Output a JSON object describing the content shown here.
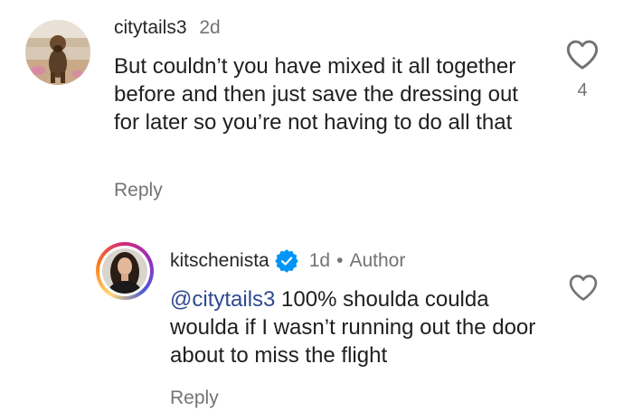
{
  "comment": {
    "username": "citytails3",
    "time": "2d",
    "text": "But couldn’t you have mixed it all together before and then just save the dressing out for later so you’re not having to do all that",
    "reply_label": "Reply",
    "like_count": "4"
  },
  "reply": {
    "username": "kitschenista",
    "time": "1d",
    "separator": "•",
    "author_label": "Author",
    "mention": "@citytails3",
    "text": " 100% shoulda coulda woulda if I wasn’t running out the door about to miss the flight",
    "reply_label": "Reply"
  },
  "icons": {
    "like": "heart-outline-icon",
    "verified": "verified-badge-icon"
  },
  "colors": {
    "text": "#262626",
    "secondary": "#737373",
    "mention": "#2e4a8e",
    "verified": "#0095f6"
  }
}
